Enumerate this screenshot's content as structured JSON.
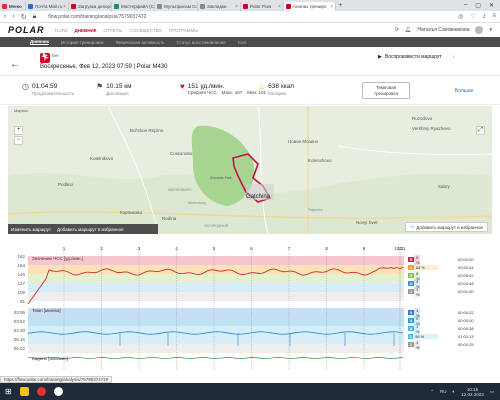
{
  "browser": {
    "menu_label": "Меню",
    "tabs": [
      {
        "label": "Почта Mail.ru",
        "color": "#1f6fd1"
      },
      {
        "label": "Загрузка депорт",
        "color": "#d10027"
      },
      {
        "label": "Мастерфайл (Co",
        "color": "#1f8f5f"
      },
      {
        "label": "Мультфильм Co",
        "color": "#8a8a8a"
      },
      {
        "label": "Закладки",
        "color": "#8a8a8a"
      },
      {
        "label": "Polar Flow",
        "color": "#d10027"
      },
      {
        "label": "Анализ трениро",
        "color": "#d10027",
        "active": true
      }
    ],
    "url": "flow.polar.com/training/analysis/7579037472",
    "status_url": "https://flow.polar.com/training/analysis/7579037472#"
  },
  "polar": {
    "logo": "POLAR",
    "nav": [
      "FLOW",
      "ДНЕВНИК",
      "ОТЧЕТЫ",
      "СООБЩЕСТВО",
      "ПРОГРАММЫ"
    ],
    "user": "Наталья Сапожникова",
    "subnav": [
      "Дневник",
      "История тренировок",
      "Физическая активность",
      "Статус восстановления",
      "Сон"
    ]
  },
  "session": {
    "title": "Бег",
    "date": "Воскресенье, Фев 12, 2023 07:59 | Polar M430",
    "share_label": "Воспроизвести маршрут"
  },
  "stats": {
    "duration": {
      "value": "01:04:59",
      "label": "Продолжительность"
    },
    "distance": {
      "value": "10.15 км",
      "label": "Дистанция"
    },
    "hr": {
      "value": "151 уд./мин.",
      "label": "Средняя ЧСС",
      "max_label": "Макс.",
      "max": "167",
      "min_label": "Мин.",
      "min": "101"
    },
    "calories": {
      "value": "638 ккал",
      "label": "Калории"
    },
    "zone_button": "Темповая тренировка",
    "more": "Больше"
  },
  "map": {
    "labels": [
      "Ruzodovo",
      "Verkhniy Ryazhevo",
      "Bol'shoe Rejzino",
      "Новое Мозино",
      "Kotelnikovo",
      "Сокколово",
      "Kolenshovo",
      "Podlino",
      "Zvonaria Park",
      "MARIENBURG",
      "Gatchina",
      "Корпиково",
      "Rodina",
      "ЗАГОРОДНЫЙ",
      "Novyi Svet",
      "Sabry",
      "Marienburg",
      "Tatyanino"
    ],
    "route_label": "Изменить маршрут",
    "fav_label": "Добавить маршрут в избранное",
    "fav_button": "Добавить маршрут в избранное"
  },
  "chart": {
    "hr_label": "Значение ЧСС [уд./мин.]",
    "speed_label": "Темп [мин/км]",
    "cadence_label": "Каденс [шаг/мин]",
    "hr_ticks": [
      "182",
      "164",
      "146",
      "127",
      "109",
      "91"
    ],
    "pace_ticks": [
      "03:06",
      "03:52",
      "04:30",
      "05:16",
      "06:02"
    ],
    "lap_markers": [
      "1",
      "2",
      "3",
      "4",
      "5",
      "6",
      "7",
      "8",
      "9",
      "10",
      "10:11"
    ],
    "hr_zones": [
      {
        "num": "5",
        "pct": "0 %",
        "time": "00:00:00",
        "color": "#d6284c"
      },
      {
        "num": "4",
        "pct": "83 %",
        "time": "00:52:04",
        "color": "#f2a21b"
      },
      {
        "num": "3",
        "pct": "8 %",
        "time": "00:05:02",
        "color": "#8bc53f"
      },
      {
        "num": "2",
        "pct": "4 %",
        "time": "00:04:48",
        "color": "#2d9fd8"
      },
      {
        "num": "1",
        "pct": "1 %",
        "time": "00:01:00",
        "color": "#9b9b9b"
      }
    ],
    "pace_zones": [
      {
        "num": "5",
        "pct": "1 %",
        "time": "00:00:22",
        "color": "#3a7bc8"
      },
      {
        "num": "4",
        "pct": "0 %",
        "time": "00:00:00",
        "color": "#2aa3d9"
      },
      {
        "num": "3",
        "pct": "1 %",
        "time": "00:00:38",
        "color": "#4cb8e0"
      },
      {
        "num": "2",
        "pct": "96 %",
        "time": "01:02:13",
        "color": "#4cb8e0"
      },
      {
        "num": "1",
        "pct": "1 %",
        "time": "00:00:25",
        "color": "#9b9b9b"
      }
    ]
  },
  "taskbar": {
    "time": "10:15",
    "date": "12.02.2023",
    "lang": "RU"
  }
}
